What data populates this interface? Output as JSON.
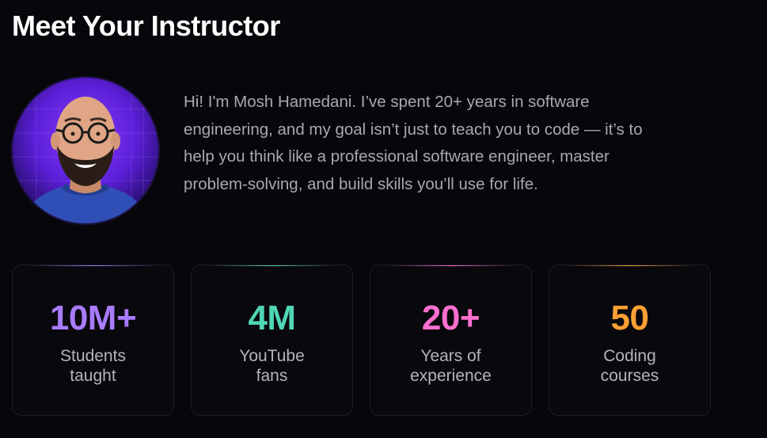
{
  "section": {
    "title": "Meet Your Instructor"
  },
  "instructor": {
    "bio": "Hi! I'm Mosh Hamedani. I’ve spent 20+ years in software engineering, and my goal isn’t just to teach you to code — it’s to help you think like a professional software engineer, master problem-solving, and build skills you’ll use for life."
  },
  "stats": [
    {
      "value": "10M+",
      "label_line1": "Students",
      "label_line2": "taught",
      "color": "#a97bff"
    },
    {
      "value": "4M",
      "label_line1": "YouTube",
      "label_line2": "fans",
      "color": "#4fd6b4"
    },
    {
      "value": "20+",
      "label_line1": "Years of",
      "label_line2": "experience",
      "color": "#ff6fd0"
    },
    {
      "value": "50",
      "label_line1": "Coding",
      "label_line2": "courses",
      "color": "#ffa033"
    }
  ]
}
